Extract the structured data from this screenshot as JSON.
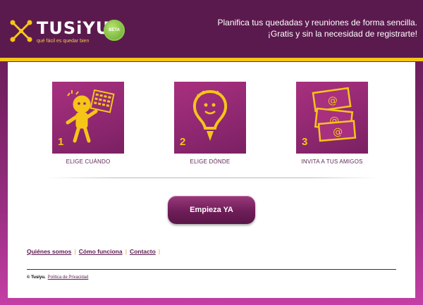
{
  "brand": {
    "name": "TUSiYU",
    "tagline": "qué fácil es quedar bien",
    "beta_badge": "BETA",
    "colors": {
      "header": "#5b1a4d",
      "accent": "#f5c518",
      "tile": "#8e2770",
      "beta": "#6cb33f"
    }
  },
  "header": {
    "tagline_line1": "Planifica tus quedadas y reuniones de forma sencilla.",
    "tagline_line2": "¡Gratis y sin la necesidad de registrarte!"
  },
  "steps": [
    {
      "number": "1",
      "label": "ELIGE CUÁNDO",
      "icon": "calendar-person-icon"
    },
    {
      "number": "2",
      "label": "ELIGE DÓNDE",
      "icon": "lightbulb-icon"
    },
    {
      "number": "3",
      "label": "INVITA A TUS AMIGOS",
      "icon": "envelopes-at-icon"
    }
  ],
  "cta": {
    "label": "Empieza YA"
  },
  "footer": {
    "links": [
      "Quiénes somos",
      "Cómo funciona",
      "Contacto"
    ],
    "copyright_brand": "© Tusiyu.",
    "privacy_link": "Política de Privacidad"
  }
}
